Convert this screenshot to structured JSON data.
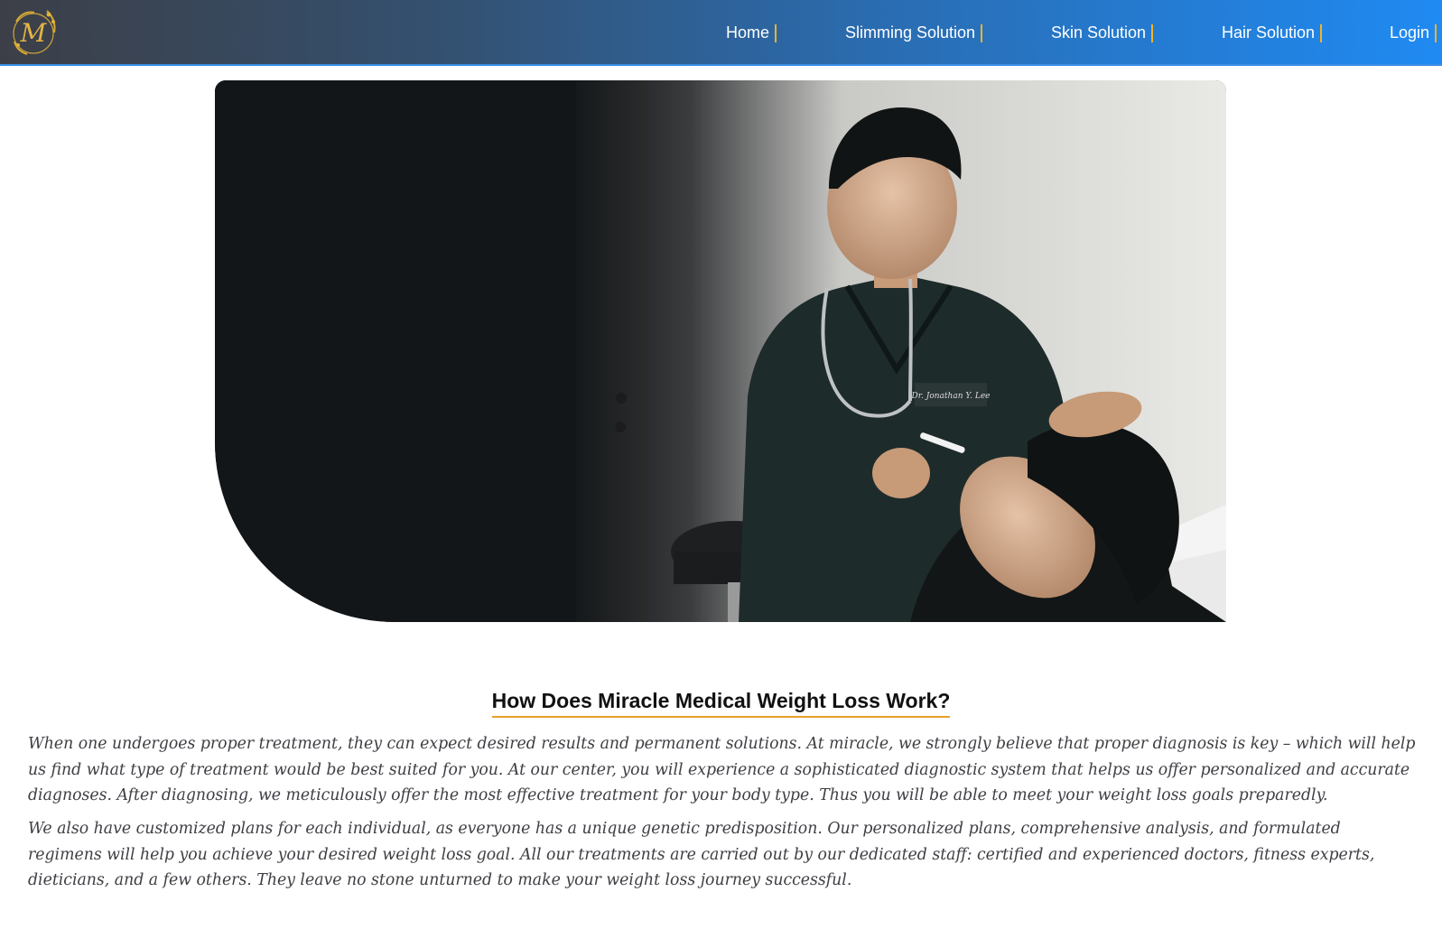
{
  "brand": {
    "logo_letter": "M"
  },
  "nav": {
    "items": [
      {
        "label": "Home"
      },
      {
        "label": "Slimming Solution"
      },
      {
        "label": "Skin Solution"
      },
      {
        "label": "Hair Solution"
      },
      {
        "label": "Login"
      }
    ]
  },
  "hero": {
    "coat_text": "Dr. Jonathan Y. Lee"
  },
  "article": {
    "title": "How Does Miracle Medical Weight Loss Work?",
    "paragraph_1": "When one undergoes proper treatment, they can expect desired results and permanent solutions. At miracle, we strongly believe that proper diagnosis is key – which will help us find what type of treatment would be best suited for you. At our center, you will experience a sophisticated diagnostic system that helps us offer personalized and accurate diagnoses. After diagnosing, we meticulously offer the most effective treatment for your body type. Thus you will be able to meet your weight loss goals preparedly.",
    "paragraph_2": "We also have customized plans for each individual, as everyone has a unique genetic predisposition. Our personalized plans, comprehensive analysis, and formulated regimens will help you achieve your desired weight loss goal. All our treatments are carried out by our dedicated staff: certified and experienced doctors, fitness experts, dieticians, and a few others. They leave no stone unturned to make your weight loss journey successful."
  },
  "colors": {
    "accent_gold": "#e7a127",
    "nav_gradient_start": "#3c3f47",
    "nav_gradient_end": "#1f8af2"
  }
}
